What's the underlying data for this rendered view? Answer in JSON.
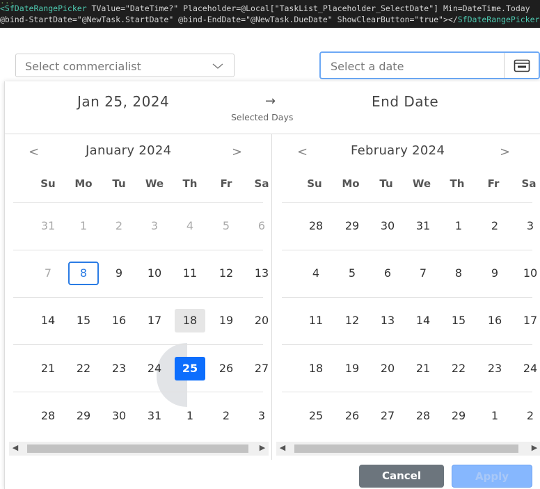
{
  "code": {
    "line0": "...",
    "line1_tag": "<SfDateRangePicker",
    "line1_rest": " TValue=\"DateTime?\" Placeholder=@Local[\"TaskList_Placeholder_SelectDate\"] Min=DateTime.Today",
    "line2_rest": "@bind-StartDate=\"@NewTask.StartDate\" @bind-EndDate=\"@NewTask.DueDate\" ShowClearButton=\"true\"></",
    "line2_tag": "SfDateRangePicker"
  },
  "commercialist_select": {
    "placeholder": "Select commercialist"
  },
  "date_input": {
    "placeholder": "Select a date"
  },
  "popup": {
    "start_date": "Jan 25, 2024",
    "arrow": "→",
    "selected_days_label": "Selected Days",
    "end_date": "End Date",
    "prev_glyph": "<",
    "next_glyph": ">",
    "weekdays": [
      "Su",
      "Mo",
      "Tu",
      "We",
      "Th",
      "Fr",
      "Sa"
    ],
    "left_month": {
      "title": "January 2024",
      "weeks": [
        [
          "31",
          "1",
          "2",
          "3",
          "4",
          "5",
          "6"
        ],
        [
          "7",
          "8",
          "9",
          "10",
          "11",
          "12",
          "13"
        ],
        [
          "14",
          "15",
          "16",
          "17",
          "18",
          "19",
          "20"
        ],
        [
          "21",
          "22",
          "23",
          "24",
          "25",
          "26",
          "27"
        ],
        [
          "28",
          "29",
          "30",
          "31",
          "1",
          "2",
          "3"
        ]
      ]
    },
    "right_month": {
      "title": "February 2024",
      "weeks": [
        [
          "28",
          "29",
          "30",
          "31",
          "1",
          "2",
          "3"
        ],
        [
          "4",
          "5",
          "6",
          "7",
          "8",
          "9",
          "10"
        ],
        [
          "11",
          "12",
          "13",
          "14",
          "15",
          "16",
          "17"
        ],
        [
          "18",
          "19",
          "20",
          "21",
          "22",
          "23",
          "24"
        ],
        [
          "25",
          "26",
          "27",
          "28",
          "29",
          "1",
          "2"
        ]
      ]
    },
    "cancel_label": "Cancel",
    "apply_label": "Apply",
    "colors": {
      "accent": "#0d6efd",
      "today_border": "#2a7be4",
      "apply_disabled": "#86b7fe",
      "cancel": "#6c757d"
    }
  }
}
